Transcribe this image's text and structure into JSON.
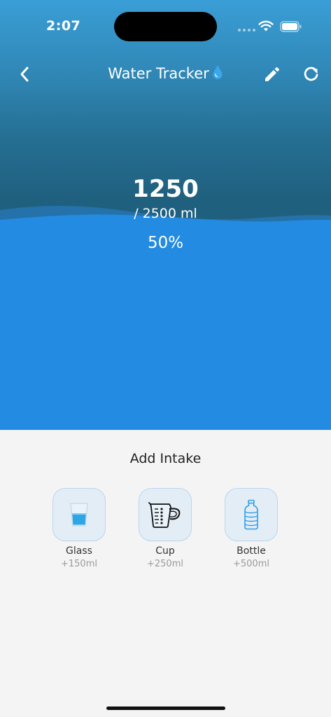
{
  "status_bar": {
    "time": "2:07"
  },
  "nav": {
    "title": "Water Tracker",
    "back_icon": "chevron-left-icon",
    "edit_icon": "pencil-icon",
    "refresh_icon": "refresh-icon",
    "title_icon": "water-drop-icon"
  },
  "progress": {
    "amount": "1250",
    "goal_text": "/ 2500 ml",
    "percent_text": "50%",
    "fill_fraction": 0.5
  },
  "intake_panel": {
    "title": "Add Intake",
    "options": [
      {
        "label": "Glass",
        "amount": "+150ml",
        "icon": "glass-icon"
      },
      {
        "label": "Cup",
        "amount": "+250ml",
        "icon": "measuring-cup-icon"
      },
      {
        "label": "Bottle",
        "amount": "+500ml",
        "icon": "bottle-icon"
      }
    ]
  },
  "colors": {
    "water": "#238be2",
    "sky_top": "#3a9ed6",
    "sky_bottom": "#20607f",
    "panel_bg": "#f4f4f4",
    "tile_bg": "#e3edf6"
  }
}
